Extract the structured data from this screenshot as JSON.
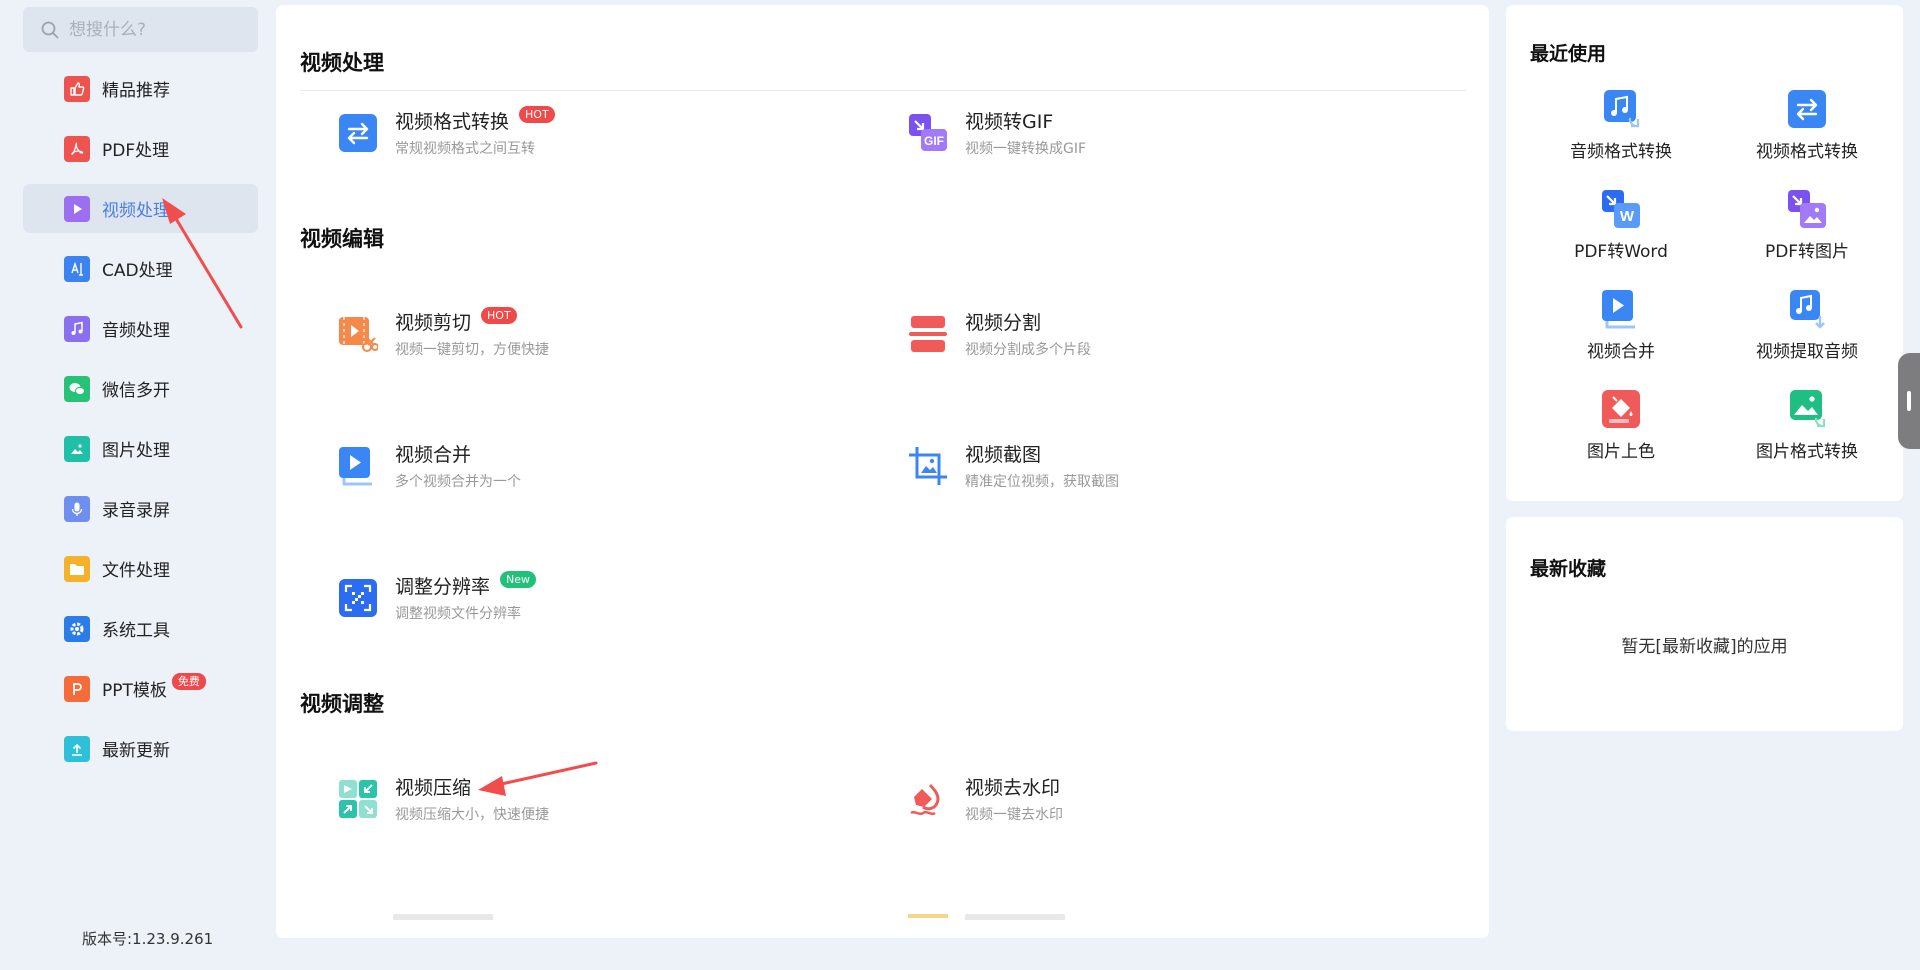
{
  "search": {
    "placeholder": "想搜什么?"
  },
  "sidebar": {
    "items": [
      {
        "label": "精品推荐",
        "icon": "thumbs-up-icon",
        "color": "#ef5350"
      },
      {
        "label": "PDF处理",
        "icon": "pdf-icon",
        "color": "#ef5350"
      },
      {
        "label": "视频处理",
        "icon": "video-play-icon",
        "color": "#9c6ef0"
      },
      {
        "label": "CAD处理",
        "icon": "cad-icon",
        "color": "#3c82f0"
      },
      {
        "label": "音频处理",
        "icon": "music-note-icon",
        "color": "#8a6ff0"
      },
      {
        "label": "微信多开",
        "icon": "wechat-icon",
        "color": "#27c277"
      },
      {
        "label": "图片处理",
        "icon": "image-icon",
        "color": "#1fbfa8"
      },
      {
        "label": "录音录屏",
        "icon": "microphone-icon",
        "color": "#6f8ff0"
      },
      {
        "label": "文件处理",
        "icon": "folder-icon",
        "color": "#f5b12a"
      },
      {
        "label": "系统工具",
        "icon": "gear-icon",
        "color": "#2a7de8"
      },
      {
        "label": "PPT模板",
        "icon": "ppt-icon",
        "color": "#f56b3a",
        "badge": "免费"
      },
      {
        "label": "最新更新",
        "icon": "upload-icon",
        "color": "#2ec0d8"
      }
    ],
    "active_index": 2,
    "version": "版本号:1.23.9.261"
  },
  "main": {
    "sections": [
      {
        "title": "视频处理"
      },
      {
        "title": "视频编辑"
      },
      {
        "title": "视频调整"
      }
    ],
    "tools": [
      {
        "name": "视频格式转换",
        "desc": "常规视频格式之间互转",
        "tag": "HOT",
        "icon": "convert-arrows-icon"
      },
      {
        "name": "视频转GIF",
        "desc": "视频一键转换成GIF",
        "icon": "gif-icon"
      },
      {
        "name": "视频剪切",
        "desc": "视频一键剪切，方便快捷",
        "tag": "HOT",
        "icon": "scissors-icon"
      },
      {
        "name": "视频分割",
        "desc": "视频分割成多个片段",
        "icon": "split-icon"
      },
      {
        "name": "视频合并",
        "desc": "多个视频合并为一个",
        "icon": "merge-video-icon"
      },
      {
        "name": "视频截图",
        "desc": "精准定位视频，获取截图",
        "icon": "crop-image-icon"
      },
      {
        "name": "调整分辨率",
        "desc": "调整视频文件分辨率",
        "tag": "New",
        "icon": "resolution-icon"
      },
      {
        "name": "视频压缩",
        "desc": "视频压缩大小，快速便捷",
        "icon": "compress-icon"
      },
      {
        "name": "视频去水印",
        "desc": "视频一键去水印",
        "icon": "watermark-remove-icon"
      }
    ]
  },
  "recent": {
    "title": "最近使用",
    "items": [
      {
        "label": "音频格式转换",
        "icon": "audio-convert-icon"
      },
      {
        "label": "视频格式转换",
        "icon": "convert-arrows-icon"
      },
      {
        "label": "PDF转Word",
        "icon": "pdf-to-word-icon"
      },
      {
        "label": "PDF转图片",
        "icon": "pdf-to-image-icon"
      },
      {
        "label": "视频合并",
        "icon": "merge-video-icon"
      },
      {
        "label": "视频提取音频",
        "icon": "extract-audio-icon"
      },
      {
        "label": "图片上色",
        "icon": "paint-bucket-icon"
      },
      {
        "label": "图片格式转换",
        "icon": "image-convert-icon"
      }
    ]
  },
  "favorites": {
    "title": "最新收藏",
    "empty_text": "暂无[最新收藏]的应用"
  }
}
